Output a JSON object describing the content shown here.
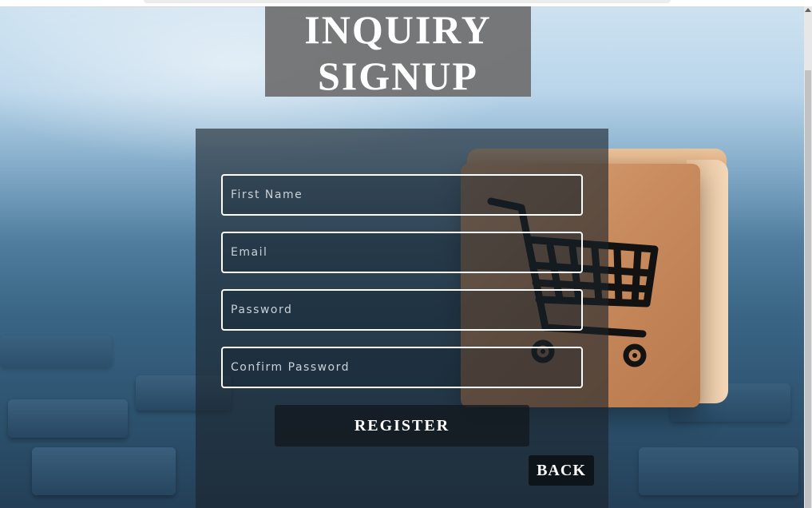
{
  "header": {
    "title_line1": "INQUIRY",
    "title_line2": "SIGNUP"
  },
  "form": {
    "first_name": {
      "placeholder": "First Name",
      "value": ""
    },
    "email": {
      "placeholder": "Email",
      "value": ""
    },
    "password": {
      "placeholder": "Password",
      "value": ""
    },
    "confirm_password": {
      "placeholder": "Confirm Password",
      "value": ""
    },
    "register_label": "REGISTER",
    "back_label": "BACK"
  },
  "background": {
    "cart_icon": "shopping-cart-icon"
  },
  "colors": {
    "title_box": "#6e6e6e",
    "panel": "#1c242c",
    "field_border": "#ffffff",
    "text": "#ffffff"
  }
}
